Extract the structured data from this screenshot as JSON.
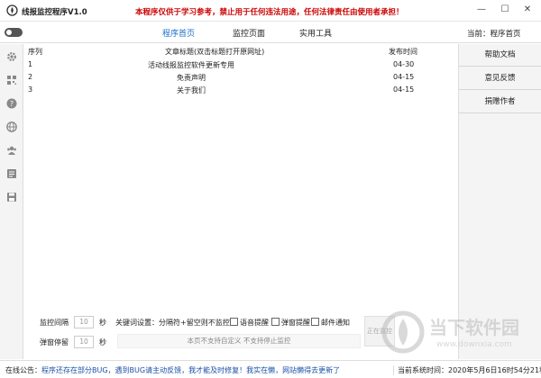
{
  "app": {
    "title": "线报监控程序V1.0",
    "notice": "本程序仅供于学习参考，禁止用于任何违法用途，任何法律责任由使用者承担！"
  },
  "nav": {
    "tabs": [
      {
        "label": "程序首页",
        "active": true
      },
      {
        "label": "监控页面",
        "active": false
      },
      {
        "label": "实用工具",
        "active": false
      }
    ],
    "current_page": "当前：程序首页"
  },
  "sidebar": {
    "icons": [
      "gear-icon",
      "qrcode-icon",
      "question-icon",
      "globe-icon",
      "users-icon",
      "list-icon",
      "save-icon"
    ]
  },
  "table": {
    "headers": {
      "index": "序列",
      "title": "文章标题(双击标题打开原网址)",
      "date": "发布时间"
    },
    "rows": [
      {
        "index": "1",
        "title": "活动线报监控软件更新专用",
        "date": "04-30"
      },
      {
        "index": "2",
        "title": "免责声明",
        "date": "04-15"
      },
      {
        "index": "3",
        "title": "关于我们",
        "date": "04-15"
      }
    ]
  },
  "right_panel": {
    "buttons": [
      "帮助文档",
      "意见反馈",
      "捐赠作者"
    ]
  },
  "controls": {
    "interval_label": "监控间隔",
    "interval_value": "10",
    "interval_unit": "秒",
    "popup_label": "弹窗停留",
    "popup_value": "10",
    "popup_unit": "秒",
    "keyword_label": "关键词设置：分隔符+留空则不监控",
    "checkboxes": [
      "语音提醒",
      "弹窗提醒",
      "邮件通知"
    ],
    "hint": "本页不支持自定义  不支持停止监控",
    "start_button": "正在监控"
  },
  "status": {
    "notice_prefix": "在线公告：",
    "notice_text": "程序还存在部分BUG，遇到BUG请主动反馈，我才能及时修复！我实在懒，网站懒得去更新了",
    "time": "当前系统时间：2020年5月6日16时54分21秒"
  },
  "watermark": {
    "text": "当下软件园",
    "url": "www.downxia.com"
  },
  "colors": {
    "accent": "#1a6fc9",
    "notice": "#cc0000"
  }
}
